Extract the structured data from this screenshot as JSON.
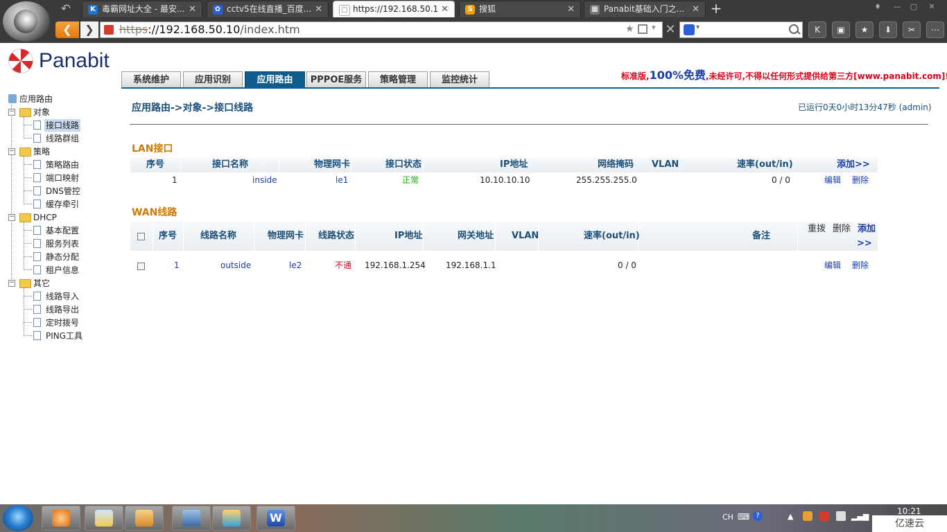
{
  "browser": {
    "tabs": [
      {
        "label": "毒霸网址大全 - 最安...",
        "favicon": "K",
        "favicon_color": "#1e74d2"
      },
      {
        "label": "cctv5在线直播_百度...",
        "favicon": "✿",
        "favicon_color": "#2a5fd8"
      },
      {
        "label": "https://192.168.50.1",
        "favicon": "▢",
        "favicon_color": "#888888"
      },
      {
        "label": "搜狐",
        "favicon": "S",
        "favicon_color": "#f0a000"
      },
      {
        "label": "Panabit基础入门之...",
        "favicon": "▦",
        "favicon_color": "#777777"
      }
    ],
    "url_scheme": "https",
    "url_host": "://192.168.50.10",
    "url_path": "/index.htm"
  },
  "page": {
    "brand": "Panabit",
    "main_tabs": [
      "系统维护",
      "应用识别",
      "应用路由",
      "PPPOE服务",
      "策略管理",
      "监控统计"
    ],
    "active_tab_index": 2,
    "license_prefix": "标准版,",
    "license_big": "100%免费",
    "license_suffix": ",未经许可,不得以任何形式提供给第三方[www.panabit.com]!",
    "breadcrumb": "应用路由->对象->接口线路",
    "uptime": "已运行0天0小时13分47秒 (admin)"
  },
  "sidebar": {
    "root": "应用路由",
    "groups": [
      {
        "label": "对象",
        "items": [
          "接口线路",
          "线路群组"
        ]
      },
      {
        "label": "策略",
        "items": [
          "策略路由",
          "端口映射",
          "DNS管控",
          "缓存牵引"
        ]
      },
      {
        "label": "DHCP",
        "items": [
          "基本配置",
          "服务列表",
          "静态分配",
          "租户信息"
        ]
      },
      {
        "label": "其它",
        "items": [
          "线路导入",
          "线路导出",
          "定时拨号",
          "PING工具"
        ]
      }
    ],
    "selected": "接口线路"
  },
  "lan": {
    "title": "LAN接口",
    "headers": [
      "序号",
      "接口名称",
      "物理网卡",
      "接口状态",
      "IP地址",
      "网络掩码",
      "VLAN",
      "速率(out/in)",
      "添加>>"
    ],
    "rows": [
      {
        "no": "1",
        "name": "inside",
        "nic": "le1",
        "status": "正常",
        "ip": "10.10.10.10",
        "mask": "255.255.255.0",
        "vlan": "",
        "rate": "0 / 0",
        "edit": "编辑",
        "delete": "删除"
      }
    ]
  },
  "wan": {
    "title": "WAN线路",
    "headers": [
      "序号",
      "线路名称",
      "物理网卡",
      "线路状态",
      "IP地址",
      "网关地址",
      "VLAN",
      "速率(out/in)",
      "备注"
    ],
    "actions": {
      "redial": "重拨",
      "delete": "删除",
      "add": "添加",
      "more": ">>"
    },
    "rows": [
      {
        "no": "1",
        "name": "outside",
        "nic": "le2",
        "status": "不通",
        "ip": "192.168.1.254",
        "gateway": "192.168.1.1",
        "vlan": "",
        "rate": "0 / 0",
        "note": "",
        "edit": "编辑",
        "delete": "删除"
      }
    ]
  },
  "taskbar": {
    "lang": "CH",
    "clock": "10:21",
    "watermark": "亿速云"
  }
}
